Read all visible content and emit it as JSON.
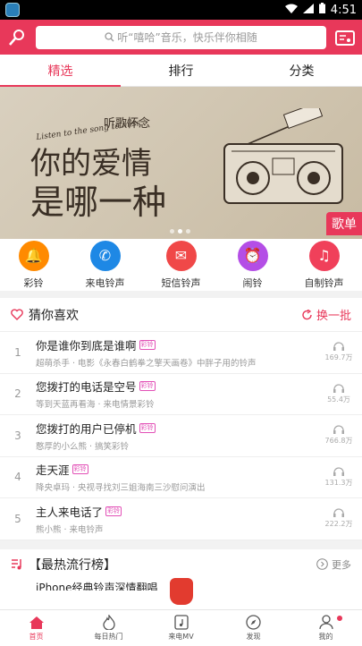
{
  "status": {
    "time": "4:51"
  },
  "search": {
    "placeholder": "听“嘻哈”音乐，快乐伴你相随"
  },
  "tabs": [
    "精选",
    "排行",
    "分类"
  ],
  "banner": {
    "line_small": "听歌怀念",
    "line_en": "Listen to the song to miss",
    "line1": "你的爱情",
    "line2": "是哪一种",
    "tag": "歌单"
  },
  "categories": [
    {
      "label": "彩铃",
      "color": "#ff8a00"
    },
    {
      "label": "来电铃声",
      "color": "#1e88e5"
    },
    {
      "label": "短信铃声",
      "color": "#f04848"
    },
    {
      "label": "闹铃",
      "color": "#b44ee6"
    },
    {
      "label": "自制铃声",
      "color": "#f0405a"
    }
  ],
  "guess": {
    "title": "猜你喜欢",
    "refresh": "换一批"
  },
  "songs": [
    {
      "idx": "1",
      "name": "你是谁你到底是谁啊",
      "badge": "彩铃",
      "sub": "超萌杀手 · 电影《永春白鹤拳之擎天画卷》中胖子用的铃声",
      "plays": "169.7万"
    },
    {
      "idx": "2",
      "name": "您拨打的电话是空号",
      "badge": "彩铃",
      "sub": "等到天蓝再看海 · 来电情景彩铃",
      "plays": "55.4万"
    },
    {
      "idx": "3",
      "name": "您拨打的用户已停机",
      "badge": "彩铃",
      "sub": "憨厚的小么熊 · 搞笑彩铃",
      "plays": "766.8万"
    },
    {
      "idx": "4",
      "name": "走天涯",
      "badge": "彩铃",
      "sub": "降央卓玛 · 央视寻找刘三姐海南三沙慰问演出",
      "plays": "131.3万"
    },
    {
      "idx": "5",
      "name": "主人来电话了",
      "badge": "彩铃",
      "sub": "熊小熊 · 来电铃声",
      "plays": "222.2万"
    }
  ],
  "hot": {
    "title": "【最热流行榜】",
    "more": "更多",
    "first": "iPhone经典铃声深情翻唱"
  },
  "bottom_nav": [
    "首页",
    "每日热门",
    "来电MV",
    "发现",
    "我的"
  ],
  "accent": "#e8385a"
}
